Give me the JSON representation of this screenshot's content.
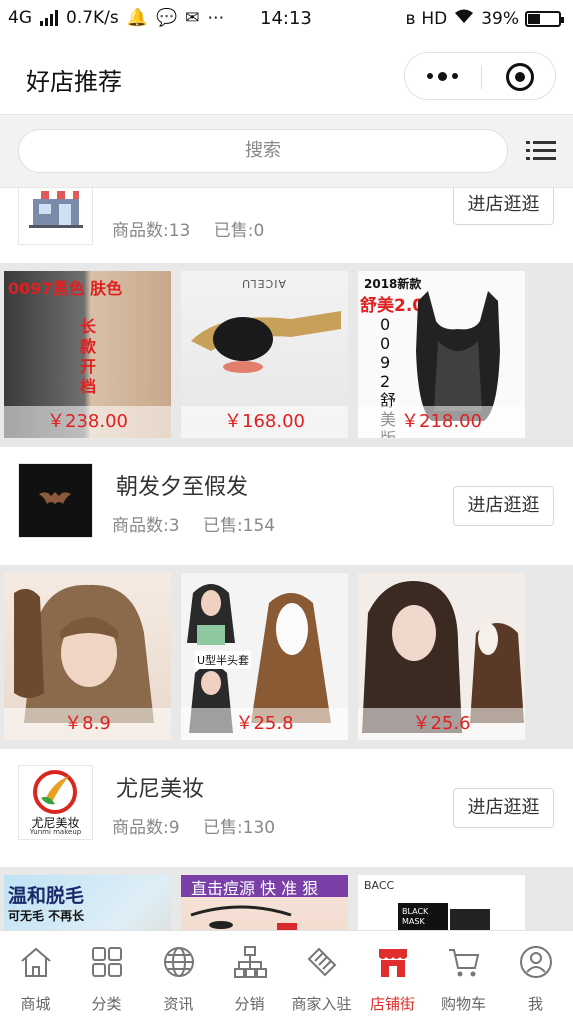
{
  "status_bar": {
    "signal": "4G",
    "speed": "0.7K/s",
    "time": "14:13",
    "network": "HD",
    "battery": "39%"
  },
  "header": {
    "title": "好店推荐"
  },
  "search": {
    "placeholder": "搜索"
  },
  "shops": [
    {
      "name": "",
      "logo_icon": "storefront-icon",
      "goods_count": "商品数:13",
      "sold": "已售:0",
      "button": "进店逛逛",
      "products": [
        {
          "price": "￥238.00",
          "overlay_text": "0097黑色  肤色",
          "overlay_text2": "长款开档"
        },
        {
          "price": "￥168.00",
          "overlay_text": "AICELU"
        },
        {
          "price": "￥218.00",
          "overlay_text": "2018新款",
          "overlay_text2": "舒美2.0",
          "overlay_text3": "0092舒美版"
        }
      ]
    },
    {
      "name": "朝发夕至假发",
      "logo_icon": "bat-logo-icon",
      "goods_count": "商品数:3",
      "sold": "已售:154",
      "button": "进店逛逛",
      "products": [
        {
          "price": "￥8.9"
        },
        {
          "price": "￥25.8",
          "overlay_text": "U型半头套"
        },
        {
          "price": "￥25.6"
        }
      ]
    },
    {
      "name": "尤尼美妆",
      "logo_icon": "yunmi-logo-icon",
      "logo_text": "尤尼美妆",
      "logo_subtext": "Yunmi makeup",
      "goods_count": "商品数:9",
      "sold": "已售:130",
      "button": "进店逛逛",
      "products": [
        {
          "price": "",
          "overlay_text": "温和脱毛",
          "overlay_text2": "可无毛 不再长"
        },
        {
          "price": "",
          "overlay_text": "直击痘源  快 准 狠"
        },
        {
          "price": "",
          "overlay_text": "BACC",
          "overlay_text2": "BLACK MASK"
        }
      ]
    }
  ],
  "tabbar": {
    "items": [
      {
        "label": "商城",
        "icon": "home-icon"
      },
      {
        "label": "分类",
        "icon": "grid-icon"
      },
      {
        "label": "资讯",
        "icon": "globe-icon"
      },
      {
        "label": "分销",
        "icon": "hierarchy-icon"
      },
      {
        "label": "商家入驻",
        "icon": "handshake-icon"
      },
      {
        "label": "店铺街",
        "icon": "shop-icon"
      },
      {
        "label": "购物车",
        "icon": "cart-icon"
      },
      {
        "label": "我",
        "icon": "user-icon"
      }
    ],
    "active_index": 5,
    "active_color": "#e02e2e"
  }
}
